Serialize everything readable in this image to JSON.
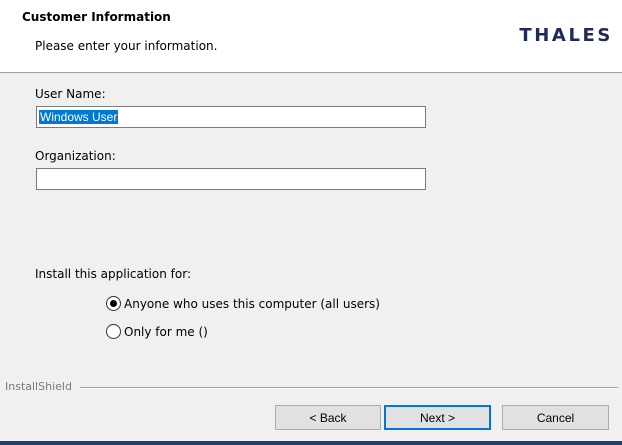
{
  "header": {
    "title": "Customer Information",
    "subtitle": "Please enter your information.",
    "logo_text": "THALES"
  },
  "form": {
    "user_name_label": "User Name:",
    "user_name_value": "Windows User",
    "organization_label": "Organization:",
    "organization_value": "",
    "install_for_label": "Install this application for:",
    "options": [
      {
        "label": "Anyone who uses this computer (all users)",
        "selected": true
      },
      {
        "label": "Only for me ()",
        "selected": false
      }
    ]
  },
  "footer": {
    "brand": "InstallShield",
    "back_label": "< Back",
    "next_label": "Next >",
    "cancel_label": "Cancel"
  },
  "colors": {
    "logo": "#1f2a55",
    "selection": "#0078d7",
    "default_button_border": "#0078d7",
    "bottom_bar": "#1d3f6b"
  }
}
